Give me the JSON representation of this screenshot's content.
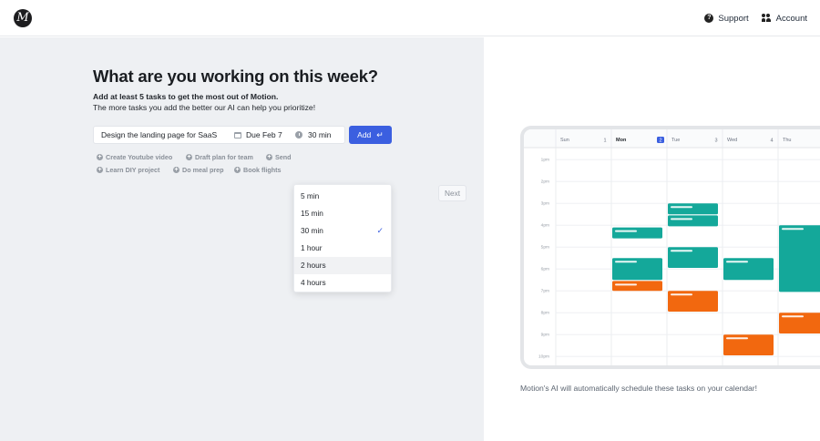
{
  "header": {
    "logo_letter": "M",
    "support_label": "Support",
    "account_label": "Account"
  },
  "onboarding": {
    "title": "What are you working on this week?",
    "subtitle_bold": "Add at least 5 tasks to get the most out of Motion.",
    "subtitle": "The more tasks you add the better our AI can help you prioritize!",
    "task_value": "Design the landing page for SaaS",
    "due_label": "Due Feb 7",
    "duration_value": "30 min",
    "add_label": "Add",
    "enter_symbol": "↵",
    "next_label": "Next",
    "suggestions": [
      "Create Youtube video",
      "Draft plan for team",
      "Send",
      "Learn DIY project",
      "Do meal prep",
      "Book flights"
    ]
  },
  "duration_dropdown": {
    "options": [
      "5 min",
      "15 min",
      "30 min",
      "1 hour",
      "2 hours",
      "4 hours"
    ],
    "selected": "30 min",
    "hovered": "2 hours"
  },
  "calendar_preview": {
    "days": [
      {
        "name": "Sun",
        "num": "1"
      },
      {
        "name": "Mon",
        "num": "2"
      },
      {
        "name": "Tue",
        "num": "3"
      },
      {
        "name": "Wed",
        "num": "4"
      },
      {
        "name": "Thu",
        "num": ""
      }
    ],
    "today_index": 1,
    "times": [
      "1pm",
      "2pm",
      "3pm",
      "4pm",
      "5pm",
      "6pm",
      "7pm",
      "8pm",
      "9pm",
      "10pm"
    ],
    "events": [
      {
        "day": 1,
        "start": 4.1,
        "end": 4.6,
        "color": "teal"
      },
      {
        "day": 1,
        "start": 5.5,
        "end": 6.5,
        "color": "teal"
      },
      {
        "day": 1,
        "start": 6.55,
        "end": 7.0,
        "color": "orange"
      },
      {
        "day": 2,
        "start": 3.0,
        "end": 3.5,
        "color": "teal"
      },
      {
        "day": 2,
        "start": 3.55,
        "end": 4.05,
        "color": "teal"
      },
      {
        "day": 2,
        "start": 5.0,
        "end": 5.95,
        "color": "teal"
      },
      {
        "day": 2,
        "start": 7.0,
        "end": 7.95,
        "color": "orange"
      },
      {
        "day": 3,
        "start": 5.5,
        "end": 6.5,
        "color": "teal"
      },
      {
        "day": 3,
        "start": 9.0,
        "end": 9.95,
        "color": "orange"
      },
      {
        "day": 4,
        "start": 4.0,
        "end": 7.05,
        "color": "teal"
      },
      {
        "day": 4,
        "start": 8.0,
        "end": 8.95,
        "color": "orange"
      }
    ],
    "colors": {
      "teal": "#14a89a",
      "orange": "#f2680f",
      "accent": "#3b5fe0"
    },
    "caption": "Motion's AI will automatically schedule these tasks on your calendar!"
  }
}
